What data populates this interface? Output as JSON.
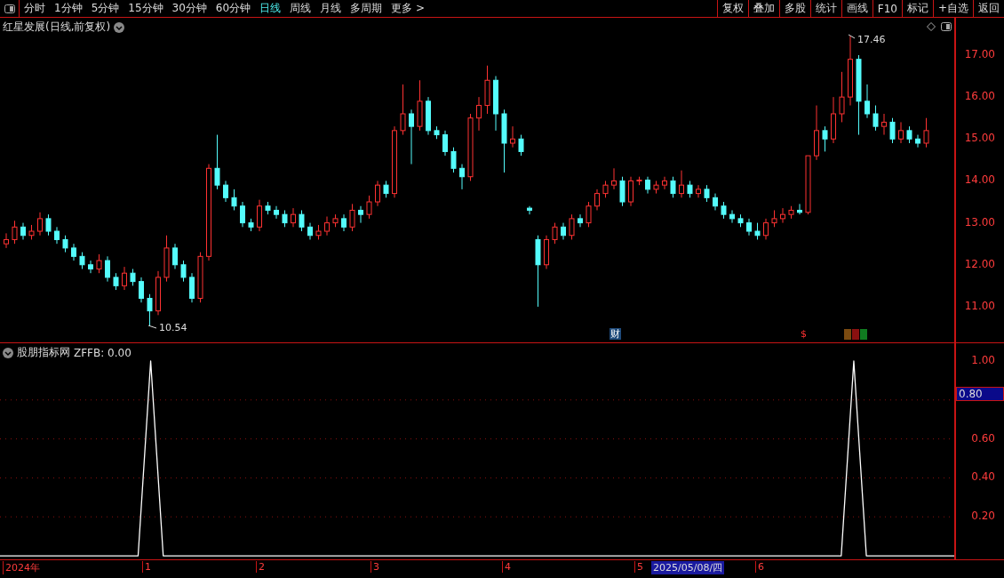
{
  "toolbar": {
    "periods": [
      {
        "label": "分时",
        "selected": false
      },
      {
        "label": "1分钟",
        "selected": false
      },
      {
        "label": "5分钟",
        "selected": false
      },
      {
        "label": "15分钟",
        "selected": false
      },
      {
        "label": "30分钟",
        "selected": false
      },
      {
        "label": "60分钟",
        "selected": false
      },
      {
        "label": "日线",
        "selected": true
      },
      {
        "label": "周线",
        "selected": false
      },
      {
        "label": "月线",
        "selected": false
      },
      {
        "label": "多周期",
        "selected": false
      },
      {
        "label": "更多 >",
        "selected": false
      }
    ],
    "actions": [
      "复权",
      "叠加",
      "多股",
      "统计",
      "画线",
      "F10",
      "标记",
      "+自选",
      "返回"
    ]
  },
  "price_chart": {
    "title": "红星发展(日线,前复权)",
    "high_label": "17.46",
    "low_label": "10.54",
    "chart_data": {
      "type": "candlestick",
      "categories": [
        null,
        null,
        null,
        null,
        null,
        null,
        null,
        null,
        null,
        null,
        null,
        null,
        null,
        null,
        null,
        null,
        null,
        null,
        null,
        null,
        null,
        null,
        null,
        null,
        null,
        null,
        null,
        null,
        null,
        null,
        null,
        null,
        null,
        null,
        null,
        null,
        null,
        null,
        null,
        null,
        null,
        null,
        null,
        null,
        null,
        null,
        null,
        null,
        null,
        null,
        null,
        null,
        null,
        null,
        null,
        null,
        null,
        null,
        null,
        null,
        null,
        null,
        null,
        null,
        null,
        null,
        null,
        null,
        null,
        null,
        null,
        null,
        null,
        null,
        null,
        null,
        null,
        null,
        null,
        null,
        null,
        null,
        null,
        null,
        null,
        null,
        null,
        null,
        null,
        null,
        null,
        null,
        null,
        null,
        null,
        null,
        null,
        null,
        null,
        null,
        null,
        null,
        null,
        null,
        null,
        null,
        null,
        null,
        null,
        null
      ],
      "ohlc": [
        [
          12.5,
          12.75,
          12.4,
          12.6
        ],
        [
          12.6,
          13.05,
          12.5,
          12.9
        ],
        [
          12.9,
          13.0,
          12.6,
          12.7
        ],
        [
          12.7,
          12.95,
          12.6,
          12.8
        ],
        [
          12.8,
          13.25,
          12.7,
          13.1
        ],
        [
          13.1,
          13.2,
          12.7,
          12.8
        ],
        [
          12.8,
          12.9,
          12.5,
          12.6
        ],
        [
          12.6,
          12.7,
          12.3,
          12.4
        ],
        [
          12.4,
          12.5,
          12.1,
          12.2
        ],
        [
          12.2,
          12.3,
          11.9,
          12.0
        ],
        [
          12.0,
          12.1,
          11.8,
          11.9
        ],
        [
          11.9,
          12.25,
          11.8,
          12.1
        ],
        [
          12.1,
          12.2,
          11.6,
          11.7
        ],
        [
          11.7,
          11.8,
          11.4,
          11.5
        ],
        [
          11.5,
          11.95,
          11.4,
          11.8
        ],
        [
          11.8,
          11.9,
          11.5,
          11.6
        ],
        [
          11.6,
          11.7,
          11.1,
          11.2
        ],
        [
          11.2,
          11.3,
          10.54,
          10.9
        ],
        [
          10.9,
          11.85,
          10.8,
          11.7
        ],
        [
          11.7,
          12.7,
          11.6,
          12.4
        ],
        [
          12.4,
          12.5,
          11.9,
          12.0
        ],
        [
          12.0,
          12.1,
          11.6,
          11.7
        ],
        [
          11.7,
          11.8,
          11.1,
          11.2
        ],
        [
          11.2,
          12.3,
          11.1,
          12.2
        ],
        [
          12.2,
          14.4,
          12.1,
          14.3
        ],
        [
          14.3,
          15.1,
          13.8,
          13.9
        ],
        [
          13.9,
          14.0,
          13.5,
          13.6
        ],
        [
          13.6,
          13.8,
          13.3,
          13.4
        ],
        [
          13.4,
          13.5,
          12.9,
          13.0
        ],
        [
          13.0,
          13.1,
          12.8,
          12.9
        ],
        [
          12.9,
          13.55,
          12.8,
          13.4
        ],
        [
          13.4,
          13.5,
          13.2,
          13.3
        ],
        [
          13.3,
          13.4,
          13.1,
          13.2
        ],
        [
          13.2,
          13.3,
          12.9,
          13.0
        ],
        [
          13.0,
          13.35,
          12.9,
          13.2
        ],
        [
          13.2,
          13.3,
          12.8,
          12.9
        ],
        [
          12.9,
          13.0,
          12.6,
          12.7
        ],
        [
          12.7,
          12.95,
          12.6,
          12.8
        ],
        [
          12.8,
          13.15,
          12.7,
          13.0
        ],
        [
          13.0,
          13.2,
          12.9,
          13.1
        ],
        [
          13.1,
          13.2,
          12.8,
          12.9
        ],
        [
          12.9,
          13.45,
          12.8,
          13.3
        ],
        [
          13.3,
          13.4,
          13.0,
          13.2
        ],
        [
          13.2,
          13.65,
          13.1,
          13.5
        ],
        [
          13.5,
          14.0,
          13.4,
          13.9
        ],
        [
          13.9,
          14.0,
          13.6,
          13.7
        ],
        [
          13.7,
          15.3,
          13.6,
          15.2
        ],
        [
          15.2,
          16.3,
          15.1,
          15.6
        ],
        [
          15.6,
          15.7,
          14.4,
          15.3
        ],
        [
          15.3,
          16.4,
          15.2,
          15.9
        ],
        [
          15.9,
          16.0,
          15.1,
          15.2
        ],
        [
          15.2,
          15.3,
          15.0,
          15.1
        ],
        [
          15.1,
          15.2,
          14.6,
          14.7
        ],
        [
          14.7,
          14.8,
          14.2,
          14.3
        ],
        [
          14.3,
          14.4,
          13.8,
          14.1
        ],
        [
          14.1,
          15.6,
          14.0,
          15.5
        ],
        [
          15.5,
          16.0,
          15.2,
          15.8
        ],
        [
          15.8,
          16.75,
          15.6,
          16.4
        ],
        [
          16.4,
          16.5,
          15.2,
          15.6
        ],
        [
          15.6,
          15.7,
          14.2,
          14.9
        ],
        [
          14.9,
          15.3,
          14.8,
          15.0
        ],
        [
          15.0,
          15.1,
          14.6,
          14.7
        ],
        [
          13.35,
          13.4,
          13.2,
          13.3
        ],
        [
          12.6,
          12.7,
          11.0,
          12.0
        ],
        [
          12.0,
          12.7,
          11.9,
          12.6
        ],
        [
          12.6,
          13.0,
          12.5,
          12.9
        ],
        [
          12.9,
          13.0,
          12.6,
          12.7
        ],
        [
          12.7,
          13.2,
          12.6,
          13.1
        ],
        [
          13.1,
          13.2,
          12.9,
          13.0
        ],
        [
          13.0,
          13.5,
          12.9,
          13.4
        ],
        [
          13.4,
          13.8,
          13.3,
          13.7
        ],
        [
          13.7,
          14.0,
          13.6,
          13.9
        ],
        [
          13.9,
          14.3,
          13.8,
          14.0
        ],
        [
          14.0,
          14.1,
          13.4,
          13.5
        ],
        [
          13.5,
          14.1,
          13.4,
          14.0
        ],
        [
          14.0,
          14.1,
          13.9,
          14.02
        ],
        [
          14.02,
          14.1,
          13.7,
          13.8
        ],
        [
          13.8,
          14.0,
          13.7,
          13.9
        ],
        [
          13.9,
          14.1,
          13.8,
          14.0
        ],
        [
          14.0,
          14.1,
          13.6,
          13.7
        ],
        [
          13.7,
          14.25,
          13.6,
          13.9
        ],
        [
          13.9,
          14.0,
          13.6,
          13.7
        ],
        [
          13.7,
          13.9,
          13.6,
          13.8
        ],
        [
          13.8,
          13.9,
          13.5,
          13.6
        ],
        [
          13.6,
          13.7,
          13.3,
          13.4
        ],
        [
          13.4,
          13.5,
          13.1,
          13.2
        ],
        [
          13.2,
          13.3,
          13.0,
          13.1
        ],
        [
          13.1,
          13.2,
          12.9,
          13.0
        ],
        [
          13.0,
          13.1,
          12.7,
          12.8
        ],
        [
          12.8,
          13.0,
          12.6,
          12.7
        ],
        [
          12.7,
          13.1,
          12.6,
          13.0
        ],
        [
          13.0,
          13.3,
          12.9,
          13.1
        ],
        [
          13.1,
          13.35,
          13.0,
          13.2
        ],
        [
          13.2,
          13.4,
          13.1,
          13.3
        ],
        [
          13.3,
          13.45,
          13.2,
          13.25
        ],
        [
          13.25,
          14.6,
          13.2,
          14.6
        ],
        [
          14.6,
          15.8,
          14.5,
          15.2
        ],
        [
          15.2,
          15.3,
          14.7,
          15.0
        ],
        [
          15.0,
          16.0,
          14.9,
          15.6
        ],
        [
          15.6,
          16.6,
          15.4,
          16.0
        ],
        [
          16.0,
          17.46,
          15.8,
          16.9
        ],
        [
          16.9,
          17.0,
          15.1,
          15.9
        ],
        [
          15.9,
          16.3,
          15.5,
          15.6
        ],
        [
          15.6,
          15.8,
          15.2,
          15.3
        ],
        [
          15.3,
          15.6,
          15.1,
          15.4
        ],
        [
          15.4,
          15.5,
          14.9,
          15.0
        ],
        [
          15.0,
          15.4,
          14.9,
          15.2
        ],
        [
          15.2,
          15.3,
          14.9,
          15.0
        ],
        [
          15.0,
          15.1,
          14.8,
          14.9
        ],
        [
          14.9,
          15.5,
          14.8,
          15.2
        ]
      ],
      "ylim": [
        10.15,
        17.89
      ],
      "yticks": [
        {
          "value": 17,
          "label": "17.00"
        },
        {
          "value": 16,
          "label": "16.00"
        },
        {
          "value": 15,
          "label": "15.00"
        },
        {
          "value": 14,
          "label": "14.00"
        },
        {
          "value": 13,
          "label": "13.00"
        },
        {
          "value": 12,
          "label": "12.00"
        },
        {
          "value": 11,
          "label": "11.00"
        }
      ]
    },
    "markers": [
      {
        "kind": "text",
        "label": "财",
        "color": "#1e4a7a"
      },
      {
        "kind": "text",
        "label": "$",
        "color": "#000000"
      },
      {
        "kind": "badge",
        "color": "#7a4a10"
      },
      {
        "kind": "badge",
        "color": "#8a1010"
      },
      {
        "kind": "badge",
        "color": "#107a20"
      }
    ]
  },
  "indicator": {
    "name": "股朋指标网",
    "value": "ZFFB: 0.00",
    "cursor_value": "0.80",
    "chart_data": {
      "type": "line",
      "categories": [
        null,
        null,
        null,
        null,
        null,
        null,
        null,
        null,
        null,
        null,
        null,
        null,
        null,
        null,
        null,
        null,
        null,
        null,
        null,
        null,
        null,
        null,
        null,
        null,
        null,
        null,
        null,
        null,
        null,
        null,
        null,
        null,
        null,
        null,
        null,
        null,
        null,
        null,
        null,
        null,
        null,
        null,
        null,
        null,
        null,
        null,
        null,
        null,
        null,
        null,
        null,
        null,
        null,
        null,
        null,
        null,
        null,
        null,
        null,
        null,
        null,
        null,
        null,
        null,
        null,
        null,
        null,
        null,
        null,
        null,
        null,
        null,
        null,
        null,
        null,
        null,
        null
      ],
      "series": [
        {
          "color": "#ffffff",
          "values": [
            0,
            0,
            0,
            0,
            0,
            0,
            0,
            0,
            0,
            0,
            0,
            0,
            1,
            0,
            0,
            0,
            0,
            0,
            0,
            0,
            0,
            0,
            0,
            0,
            0,
            0,
            0,
            0,
            0,
            0,
            0,
            0,
            0,
            0,
            0,
            0,
            0,
            0,
            0,
            0,
            0,
            0,
            0,
            0,
            0,
            0,
            0,
            0,
            0,
            0,
            0,
            0,
            0,
            0,
            0,
            0,
            0,
            0,
            0,
            0,
            0,
            0,
            0,
            0,
            0,
            0,
            0,
            0,
            1,
            0,
            0,
            0,
            0,
            0,
            0,
            0,
            0
          ]
        }
      ],
      "ylim": [
        -0.018,
        1.091
      ],
      "grid": true,
      "yticks": [
        {
          "value": 1,
          "label": "1.00"
        },
        {
          "value": 0.6,
          "label": "0.60"
        },
        {
          "value": 0.4,
          "label": "0.40"
        },
        {
          "value": 0.2,
          "label": "0.20"
        }
      ]
    }
  },
  "date_axis": {
    "labels": [
      "2024年",
      "1",
      "2",
      "3",
      "4",
      "5",
      "6"
    ],
    "cursor_date": "2025/05/08/四"
  }
}
